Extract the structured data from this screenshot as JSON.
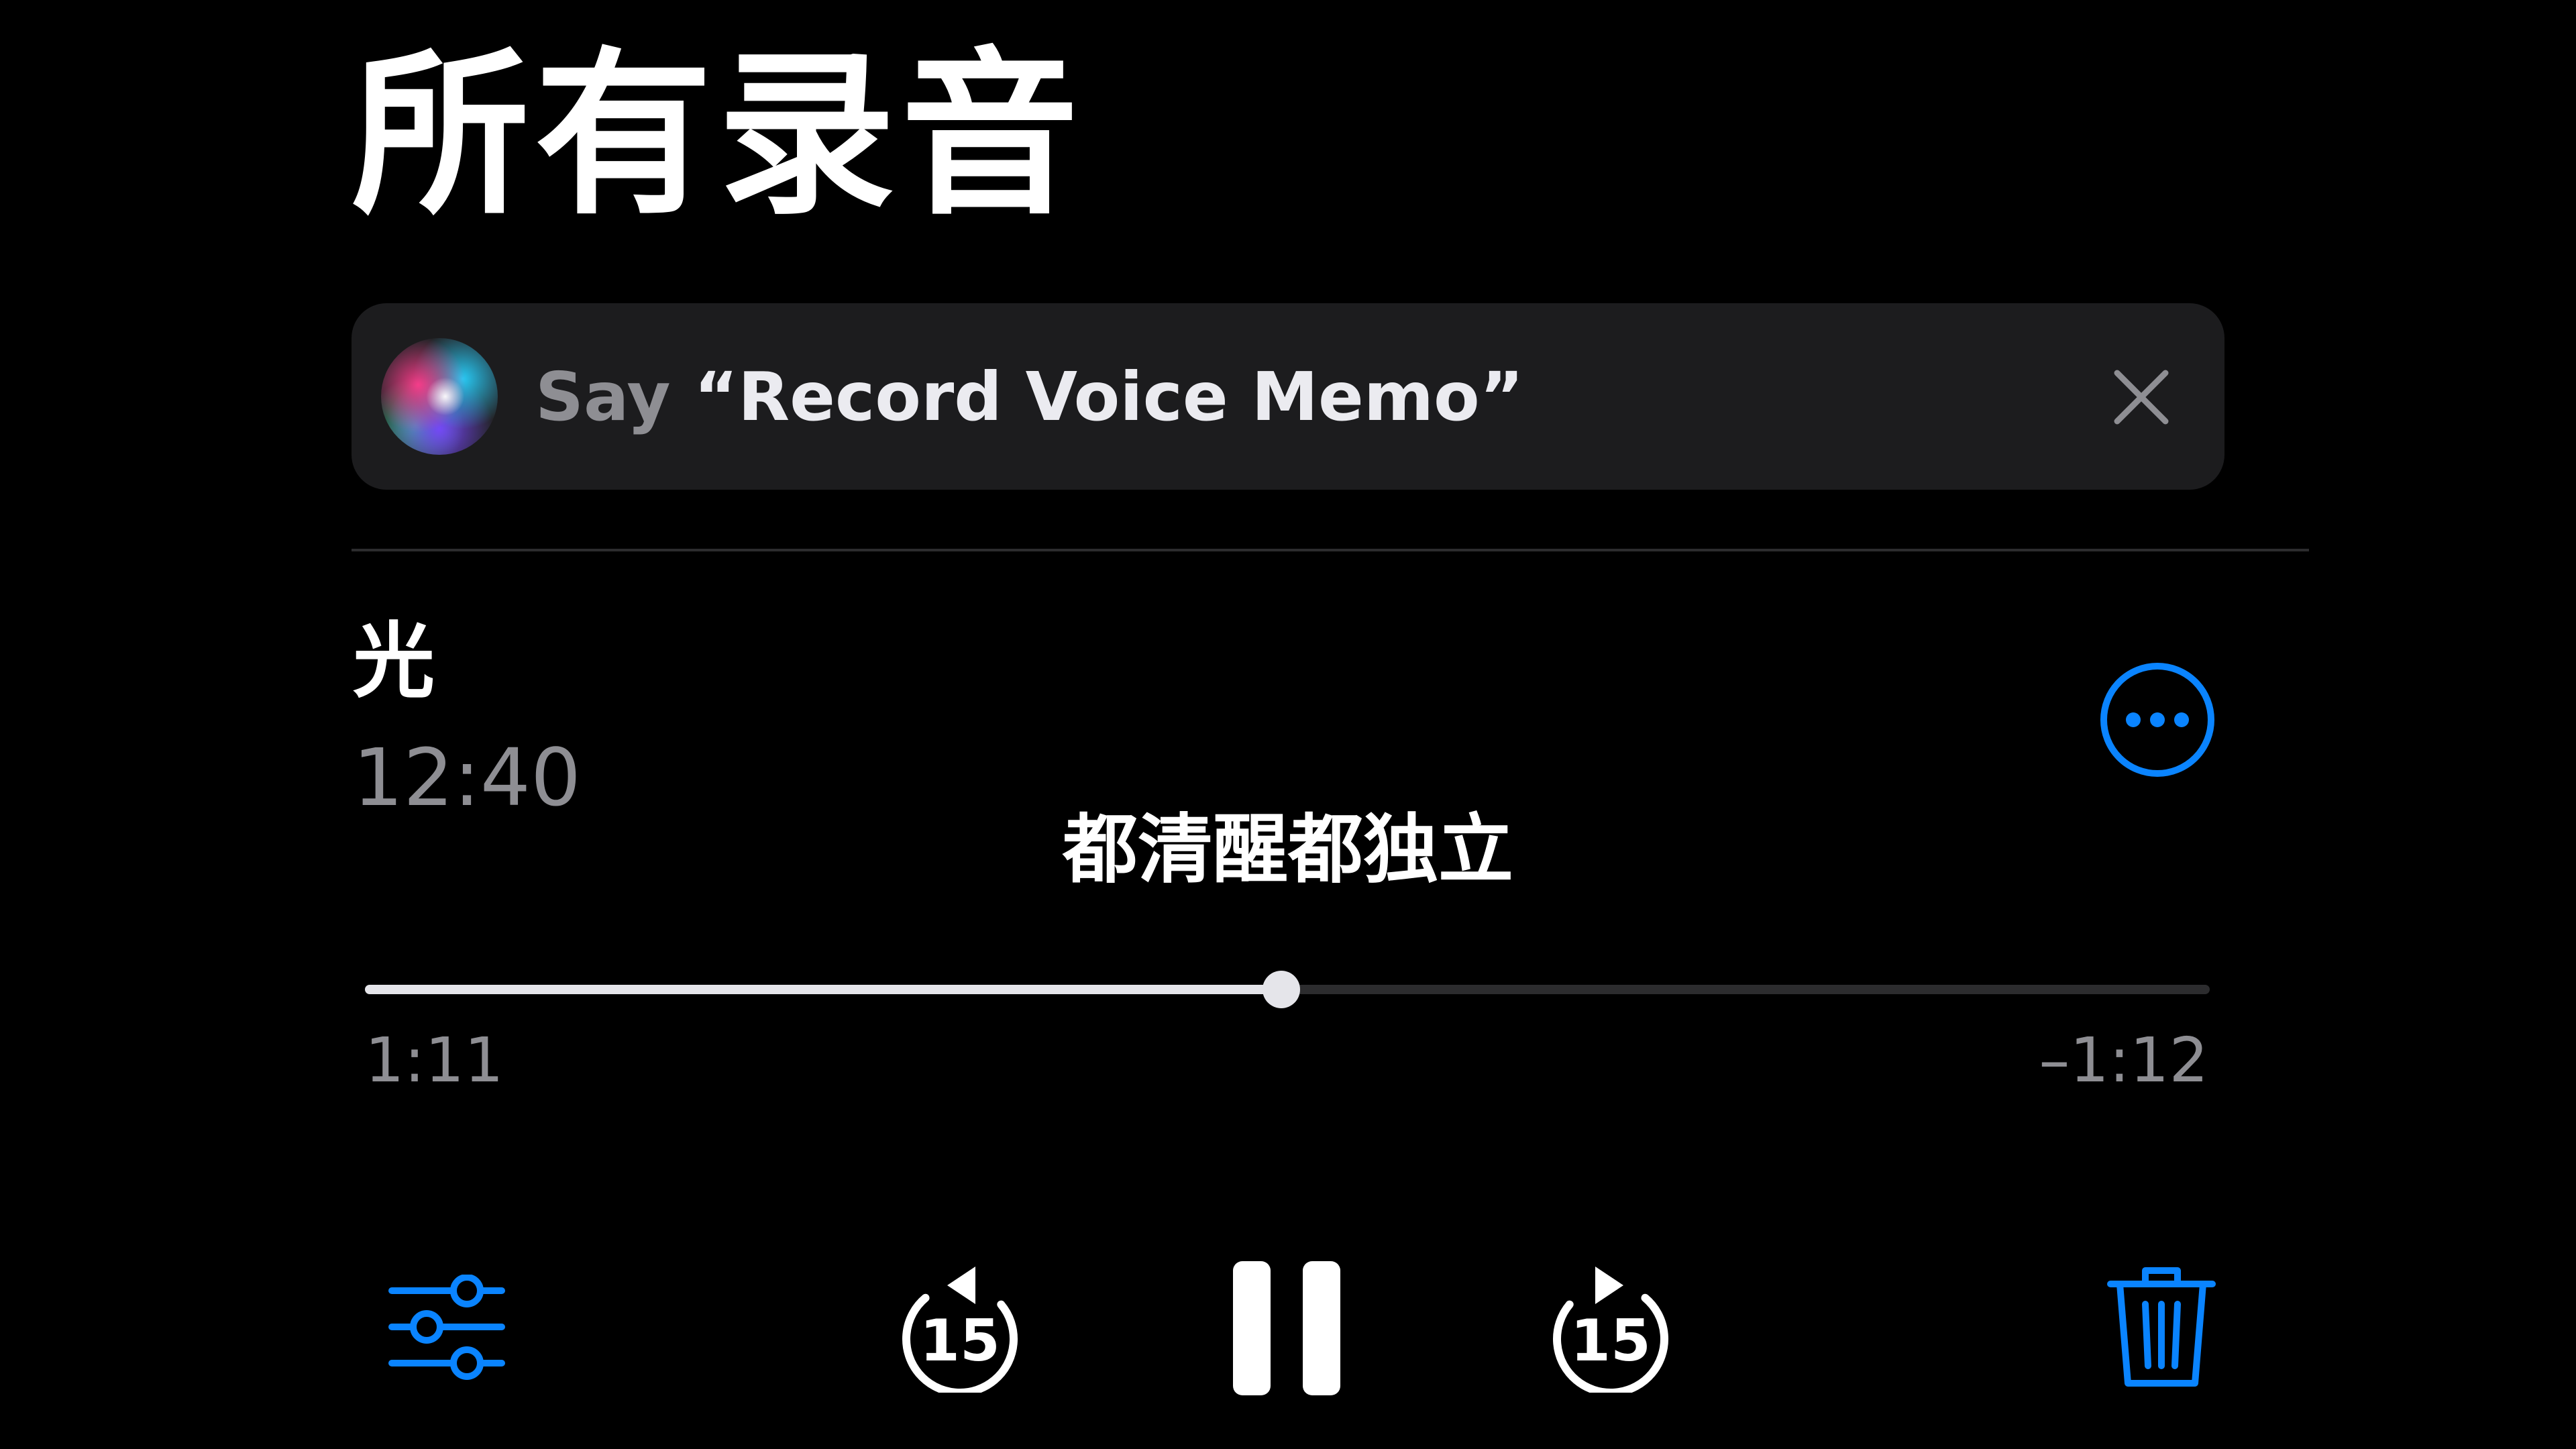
{
  "header": {
    "title": "所有录音"
  },
  "siri_banner": {
    "say": "Say ",
    "phrase": "“Record Voice Memo”",
    "icon": "siri-orb-icon",
    "close_icon": "close-icon"
  },
  "recording": {
    "title": "光",
    "date": "12:40",
    "more_icon": "ellipsis-circle-icon"
  },
  "subtitle": {
    "text": "都清醒都独立"
  },
  "playback": {
    "elapsed": "1:11",
    "remaining": "–1:12",
    "progress": 0.4966
  },
  "controls": {
    "options_icon": "sliders-icon",
    "skip_back_icon": "skip-back-15-icon",
    "skip_back_seconds": "15",
    "pause_icon": "pause-icon",
    "skip_forward_icon": "skip-forward-15-icon",
    "skip_forward_seconds": "15",
    "delete_icon": "trash-icon"
  },
  "colors": {
    "background": "#000000",
    "accent": "#0a84ff",
    "banner": "#1c1c1e",
    "secondary_text": "#8e8e93",
    "control_white": "#ffffff"
  }
}
